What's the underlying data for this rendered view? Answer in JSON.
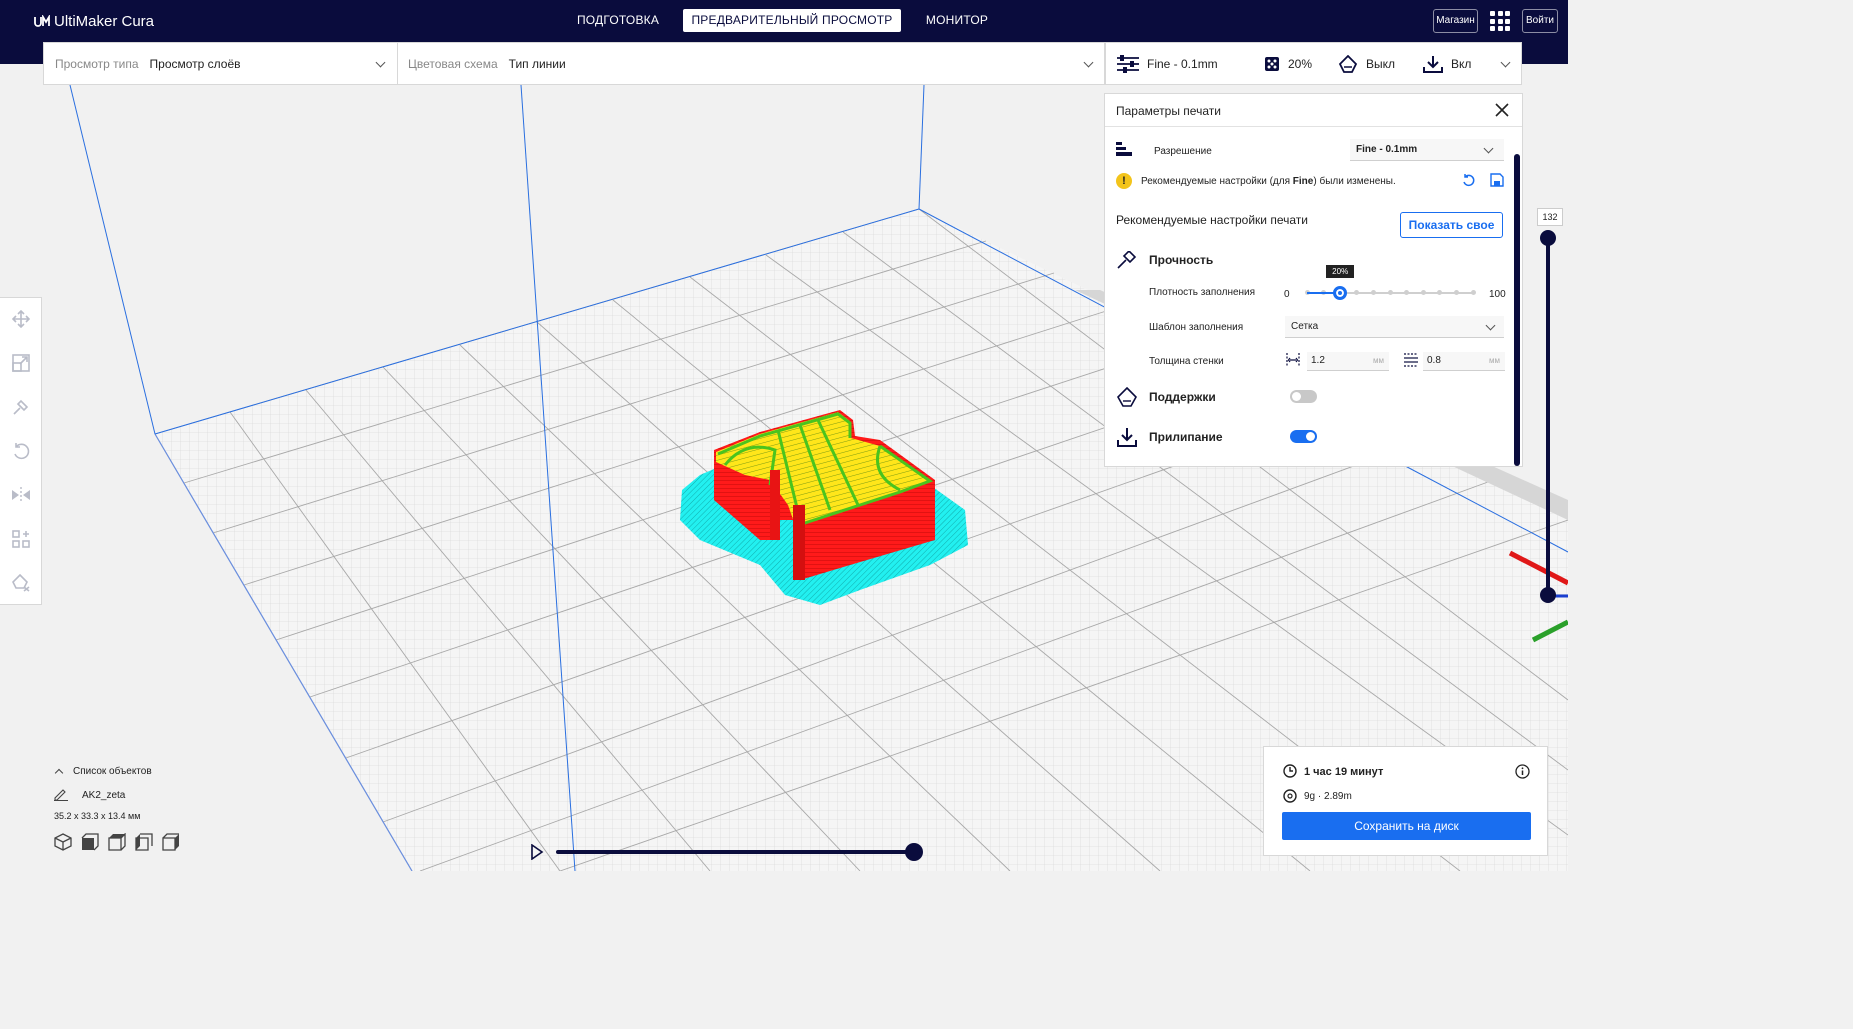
{
  "app": {
    "title": "UltiMaker Cura"
  },
  "nav": {
    "tabs": [
      {
        "label": "ПОДГОТОВКА"
      },
      {
        "label": "ПРЕДВАРИТЕЛЬНЫЙ ПРОСМОТР",
        "active": true
      },
      {
        "label": "МОНИТОР"
      }
    ],
    "marketplace_label": "Магазин",
    "signin_label": "Войти"
  },
  "viewbar": {
    "view_type_label": "Просмотр типа",
    "view_type_value": "Просмотр слоёв",
    "color_scheme_label": "Цветовая схема",
    "color_scheme_value": "Тип линии"
  },
  "print_summary": {
    "profile": "Fine - 0.1mm",
    "infill": "20%",
    "support": "Выкл",
    "adhesion": "Вкл"
  },
  "print_settings": {
    "title": "Параметры печати",
    "resolution_label": "Разрешение",
    "resolution_value": "Fine - 0.1mm",
    "warning_prefix": "Рекомендуемые настройки (для ",
    "warning_bold": "Fine",
    "warning_suffix": ") были изменены.",
    "recommended_label": "Рекомендуемые настройки печати",
    "custom_button": "Показать свое",
    "strength_label": "Прочность",
    "infill_density_label": "Плотность заполнения",
    "infill_min": "0",
    "infill_max": "100",
    "infill_value": 20,
    "infill_tooltip": "20%",
    "infill_pattern_label": "Шаблон заполнения",
    "infill_pattern_value": "Сетка",
    "wall_thickness_label": "Толщина стенки",
    "wall_value": "1.2",
    "top_bottom_value": "0.8",
    "unit_mm": "мм",
    "support_label": "Поддержки",
    "support_enabled": false,
    "adhesion_label": "Прилипание",
    "adhesion_enabled": true
  },
  "layer_slider": {
    "max_layer": "132"
  },
  "object_list": {
    "header": "Список объектов",
    "object_name": "AK2_zeta",
    "dimensions": "35.2 x 33.3 x 13.4 мм"
  },
  "estimate": {
    "time": "1 час 19 минут",
    "material": "9g · 2.89m",
    "save_label": "Сохранить на диск"
  },
  "colors": {
    "header_bg": "#0a0c3d",
    "accent": "#196ef0",
    "wall_outer": "#ff1a1a",
    "wall_inner": "#6fe02a",
    "infill": "#ffe61a",
    "skirt": "#22f0f0"
  }
}
